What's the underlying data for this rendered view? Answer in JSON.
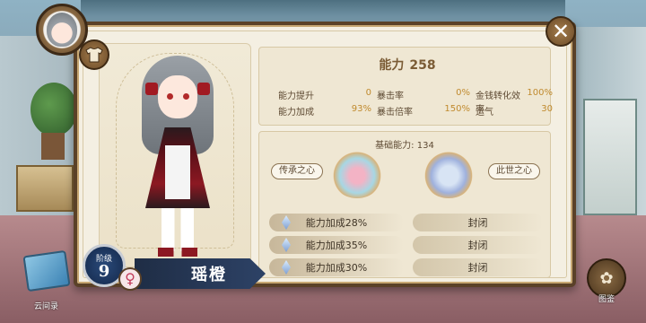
{
  "power": {
    "label": "能力",
    "value": "258"
  },
  "stats": [
    [
      {
        "label": "能力提升",
        "value": "0"
      },
      {
        "label": "暴击率",
        "value": "0%"
      },
      {
        "label": "金钱转化效率",
        "value": "100%"
      }
    ],
    [
      {
        "label": "能力加成",
        "value": "93%"
      },
      {
        "label": "暴击倍率",
        "value": "150%"
      },
      {
        "label": "运气",
        "value": "30"
      }
    ]
  ],
  "base_ability": "基础能力: 134",
  "hearts": {
    "left_label": "传承之心",
    "right_label": "此世之心"
  },
  "bonuses": [
    "能力加成28%",
    "能力加成35%",
    "能力加成30%"
  ],
  "sealed_label": "封闭",
  "character": {
    "tier_label": "阶级",
    "tier": "9",
    "name": "瑶橙",
    "gender_symbol": "♀"
  },
  "buttons": {
    "scroll_label": "云间录",
    "atlas_label": "图鉴",
    "close_symbol": "✕"
  },
  "icons": {
    "shirt": "shirt-icon",
    "close": "close-icon",
    "atlas": "atlas-icon",
    "scroll": "scroll-icon"
  },
  "colors": {
    "panel": "#f4efe2",
    "frame": "#5a4128",
    "accent": "#c08a2e",
    "banner": "#1f2d45"
  }
}
